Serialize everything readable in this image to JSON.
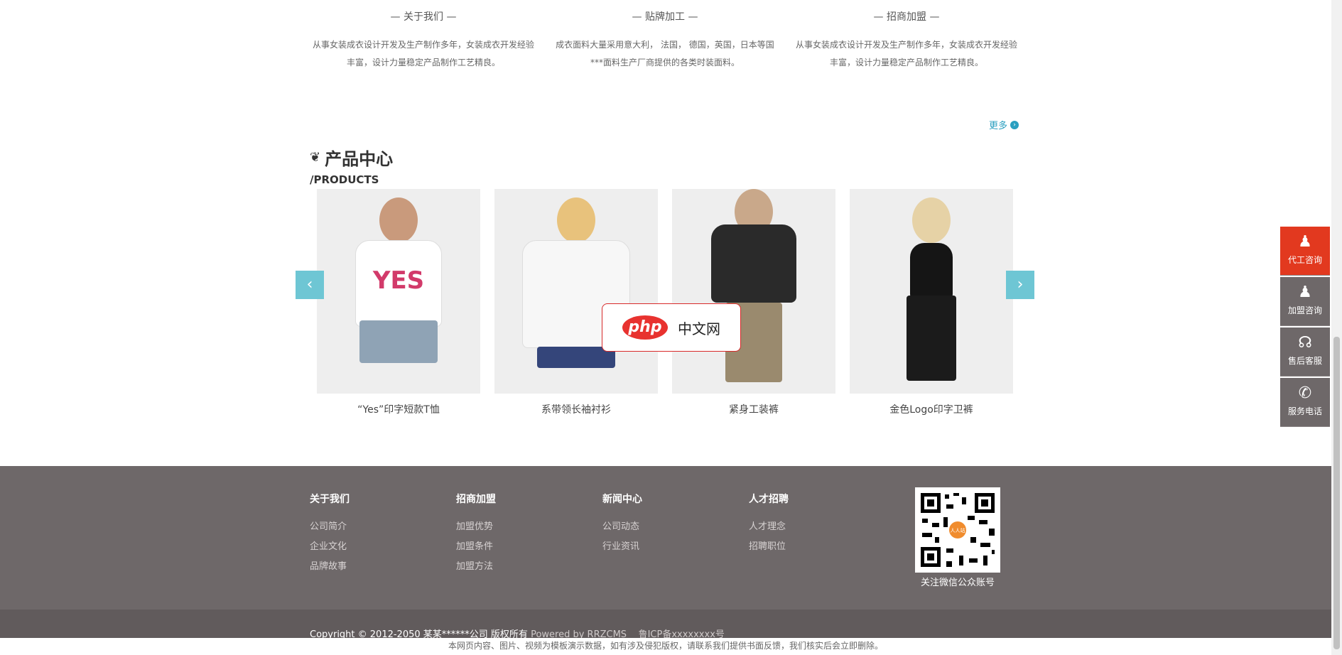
{
  "features": [
    {
      "title": "— 关于我们 —",
      "text": "从事女装成衣设计开发及生产制作多年，女装成衣开发经验丰富，设计力量稳定产品制作工艺精良。"
    },
    {
      "title": "— 贴牌加工 —",
      "text": "成衣面料大量采用意大利， 法国， 德国，英国，日本等国***面料生产厂商提供的各类时装面料。"
    },
    {
      "title": "— 招商加盟 —",
      "text": "从事女装成衣设计开发及生产制作多年，女装成衣开发经验丰富，设计力量稳定产品制作工艺精良。"
    }
  ],
  "more_label": "更多",
  "section": {
    "title": "产品中心",
    "subtitle": "/PRODUCTS"
  },
  "products": [
    {
      "name": "“Yes”印字短款T恤",
      "top": "#ffffff",
      "bottom": "#8fa3b5"
    },
    {
      "name": "系带领长袖衬衫",
      "top": "#f7f7f7",
      "bottom": "#34457a"
    },
    {
      "name": "紧身工装裤",
      "top": "#2a2a2a",
      "bottom": "#9a8a6e"
    },
    {
      "name": "金色Logo印字卫裤",
      "top": "#151515",
      "bottom": "#1b1b1b"
    }
  ],
  "carousel": {
    "prev": "‹",
    "next": "›"
  },
  "watermark": {
    "logo": "php",
    "text": "中文网"
  },
  "side_service": [
    {
      "label": "代工咨询",
      "icon": "qq-icon"
    },
    {
      "label": "加盟咨询",
      "icon": "qq-icon"
    },
    {
      "label": "售后客服",
      "icon": "headset-icon"
    },
    {
      "label": "服务电话",
      "icon": "phone-icon"
    }
  ],
  "footer": {
    "columns": [
      {
        "title": "关于我们",
        "links": [
          "公司简介",
          "企业文化",
          "品牌故事"
        ]
      },
      {
        "title": "招商加盟",
        "links": [
          "加盟优势",
          "加盟条件",
          "加盟方法"
        ]
      },
      {
        "title": "新闻中心",
        "links": [
          "公司动态",
          "行业资讯"
        ]
      },
      {
        "title": "人才招聘",
        "links": [
          "人才理念",
          "招聘职位"
        ]
      }
    ],
    "qr_caption": "关注微信公众账号",
    "qr_center": "人人站",
    "copyright": "Copyright © 2012-2050 某某******公司 版权所有",
    "powered": "Powered by RRZCMS",
    "icp": "鲁ICP备xxxxxxxx号"
  },
  "disclaimer": "本网页内容、图片、视频为模板演示数据，如有涉及侵犯版权，请联系我们提供书面反馈，我们核实后会立即删除。",
  "colors": {
    "accent": "#2a9fc0",
    "footer_bg": "#6e6869",
    "active_service": "#e2391f"
  }
}
